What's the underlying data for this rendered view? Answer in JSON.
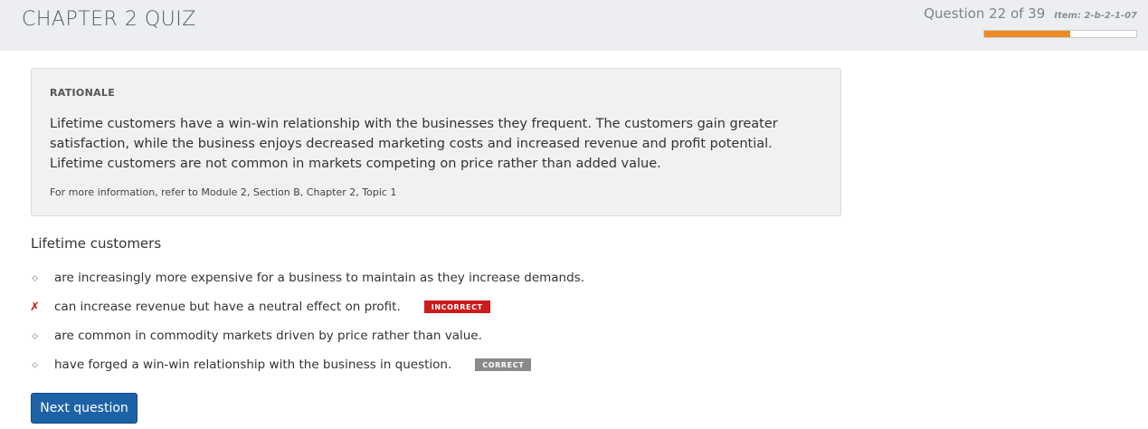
{
  "header": {
    "title": "CHAPTER 2 QUIZ",
    "question_counter": "Question 22 of 39",
    "item_code": "Item: 2-b-2-1-07",
    "progress_fraction": 0.564
  },
  "rationale": {
    "heading": "RATIONALE",
    "body": "Lifetime customers have a win-win relationship with the businesses they frequent. The customers gain greater satisfaction, while the business enjoys decreased marketing costs and increased revenue and profit potential. Lifetime customers are not common in markets competing on price rather than added value.",
    "reference": "For more information, refer to Module 2, Section B, Chapter 2, Topic 1"
  },
  "question": {
    "stem": "Lifetime customers",
    "answers": [
      {
        "text": "are increasingly more expensive for a business to maintain as they increase demands.",
        "marker": "diamond-icon",
        "badge": ""
      },
      {
        "text": "can increase revenue but have a neutral effect on profit.",
        "marker": "x-mark-icon",
        "badge": "INCORRECT"
      },
      {
        "text": "are common in commodity markets driven by price rather than value.",
        "marker": "diamond-icon",
        "badge": ""
      },
      {
        "text": "have forged a win-win relationship with the business in question.",
        "marker": "diamond-icon",
        "badge": "CORRECT"
      }
    ]
  },
  "actions": {
    "next_label": "Next question"
  },
  "colors": {
    "accent_progress": "#ee8a22",
    "incorrect": "#cc1b1b",
    "correct_badge": "#8a8a8a",
    "primary_button": "#1d62a6"
  },
  "icons": {
    "incorrect_mark": "✗"
  }
}
